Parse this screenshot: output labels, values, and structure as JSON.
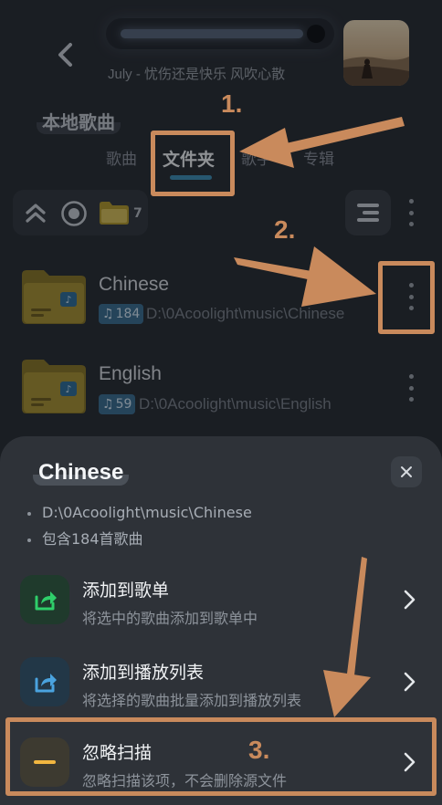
{
  "header": {
    "song_text": "July - 忧伤还是快乐  风吹心散"
  },
  "page": {
    "title": "本地歌曲",
    "tabs": [
      {
        "label": "歌曲",
        "active": false
      },
      {
        "label": "文件夹",
        "active": true
      },
      {
        "label": "歌手",
        "active": false
      },
      {
        "label": "专辑",
        "active": false
      }
    ]
  },
  "toolbar": {
    "folder_count": "7",
    "icons": [
      "collapse-all-icon",
      "locate-icon",
      "folder-icon",
      "sort-icon",
      "more-icon"
    ]
  },
  "folders": [
    {
      "name": "Chinese",
      "count": "184",
      "path": "D:\\0Acoolight\\music\\Chinese"
    },
    {
      "name": "English",
      "count": "59",
      "path": "D:\\0Acoolight\\music\\English"
    }
  ],
  "sheet": {
    "title": "Chinese",
    "details": [
      "D:\\0Acoolight\\music\\Chinese",
      "包含184首歌曲"
    ],
    "items": [
      {
        "title": "添加到歌单",
        "subtitle": "将选中的歌曲添加到歌单中",
        "icon": "share-to-playlist-icon",
        "icon_color": "#2fcf6a"
      },
      {
        "title": "添加到播放列表",
        "subtitle": "将选择的歌曲批量添加到播放列表",
        "icon": "share-to-queue-icon",
        "icon_color": "#4aa3df"
      },
      {
        "title": "忽略扫描",
        "subtitle": "忽略扫描该项，不会删除源文件",
        "icon": "ignore-icon",
        "icon_color": "#f2b640"
      }
    ]
  },
  "annotations": {
    "steps": [
      "1.",
      "2.",
      "3."
    ],
    "color": "#c98a5c"
  },
  "colors": {
    "accent": "#3f8fb5",
    "badge": "#3b6f92",
    "folder": "#b6a02e"
  }
}
